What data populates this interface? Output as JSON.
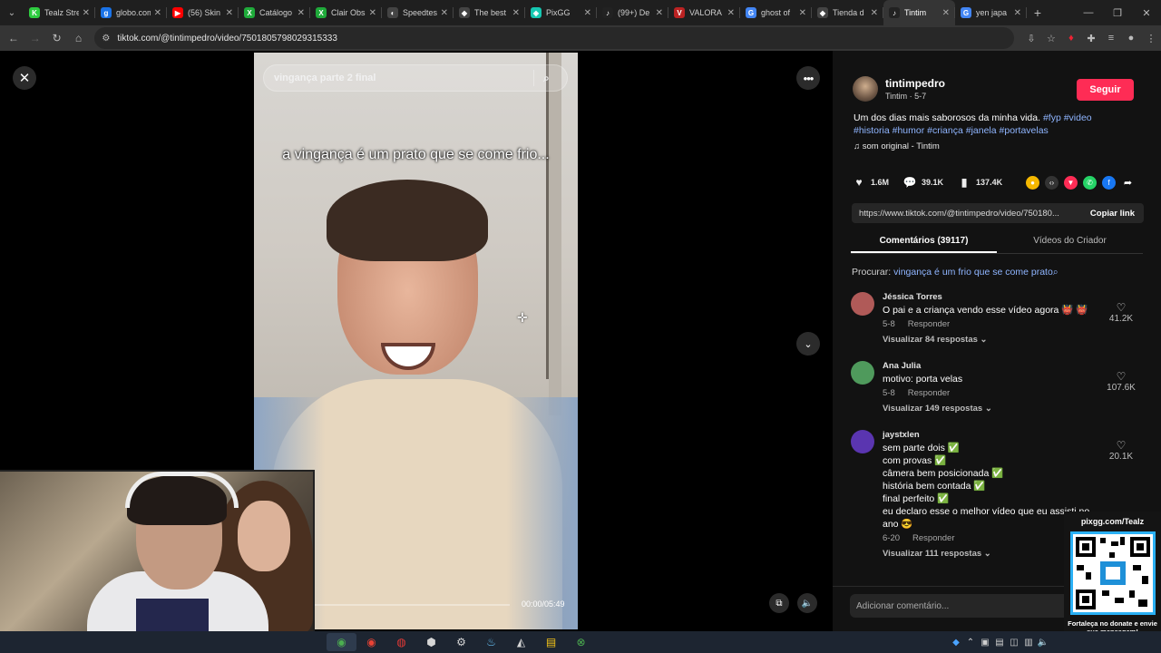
{
  "browser": {
    "tabs": [
      {
        "title": "Tealz Stre",
        "color": "#2ecc40",
        "glyph": "K"
      },
      {
        "title": "globo.com",
        "color": "#1a73e8",
        "glyph": "g"
      },
      {
        "title": "(56) Skin",
        "color": "#ff0000",
        "glyph": "▶"
      },
      {
        "title": "Catálogo",
        "color": "#1faa3a",
        "glyph": "X"
      },
      {
        "title": "Clair Obs",
        "color": "#1faa3a",
        "glyph": "X"
      },
      {
        "title": "Speedtest",
        "color": "#444",
        "glyph": "◐"
      },
      {
        "title": "The best",
        "color": "#444",
        "glyph": "◆"
      },
      {
        "title": "PixGG",
        "color": "#16c7b1",
        "glyph": "◈"
      },
      {
        "title": "(99+) De",
        "color": "#222",
        "glyph": "♪"
      },
      {
        "title": "VALORA",
        "color": "#b22",
        "glyph": "V"
      },
      {
        "title": "ghost of",
        "color": "#4285f4",
        "glyph": "G"
      },
      {
        "title": "Tienda d",
        "color": "#444",
        "glyph": "◆"
      },
      {
        "title": "Tintim",
        "color": "#222",
        "glyph": "♪"
      },
      {
        "title": "yen japa",
        "color": "#4285f4",
        "glyph": "G"
      }
    ],
    "active_tab_index": 12,
    "url": "tiktok.com/@tintimpedro/video/7501805798029315333"
  },
  "video": {
    "search_query": "vingança parte 2 final",
    "caption": "a vingança é um prato que se come frio...",
    "time": "00:00/05:49"
  },
  "panel": {
    "author_name": "tintimpedro",
    "author_sub": "Tintim · 5-7",
    "follow_label": "Seguir",
    "description_text": "Um dos dias mais saborosos da minha vida. ",
    "hashtags": "#fyp #video #historia #humor #criança #janela #portavelas",
    "sound": "som original - Tintim",
    "likes": "1.6M",
    "comments_count": "39.1K",
    "saves": "137.4K",
    "link": "https://www.tiktok.com/@tintimpedro/video/750180...",
    "copy_link_label": "Copiar link",
    "tab_comments": "Comentários (39117)",
    "tab_creator": "Vídeos do Criador",
    "procurar_label": "Procurar: ",
    "procurar_query": "vingança é um frio que se come prato",
    "add_comment_placeholder": "Adicionar comentário..."
  },
  "comments": [
    {
      "name": "Jéssica Torres",
      "text": "O pai e a criança vendo esse vídeo agora 👹 👹",
      "date": "5-8",
      "reply": "Responder",
      "replies": "Visualizar 84 respostas ⌄",
      "likes": "41.2K",
      "avatar_color": "#b05a58"
    },
    {
      "name": "Ana Julia",
      "text": "motivo: porta velas",
      "date": "5-8",
      "reply": "Responder",
      "replies": "Visualizar 149 respostas ⌄",
      "likes": "107.6K",
      "avatar_color": "#4f9a5c"
    },
    {
      "name": "jaystxlen",
      "text": "sem parte dois ✅\ncom provas ✅\ncâmera bem posicionada ✅\nhistória bem contada ✅\nfinal perfeito ✅\neu declaro esse o melhor vídeo que eu assisti no ano 😎",
      "date": "6-20",
      "reply": "Responder",
      "replies": "Visualizar 111 respostas ⌄",
      "likes": "20.1K",
      "avatar_color": "#5a35b0"
    }
  ],
  "overlay": {
    "qr_header": "pixgg.com/Tealz",
    "qr_footer": "Fortaleça no donate e envie sua mensagem!"
  },
  "colors": {
    "accent": "#fe2c55",
    "hashtag": "#8fb5ff"
  }
}
